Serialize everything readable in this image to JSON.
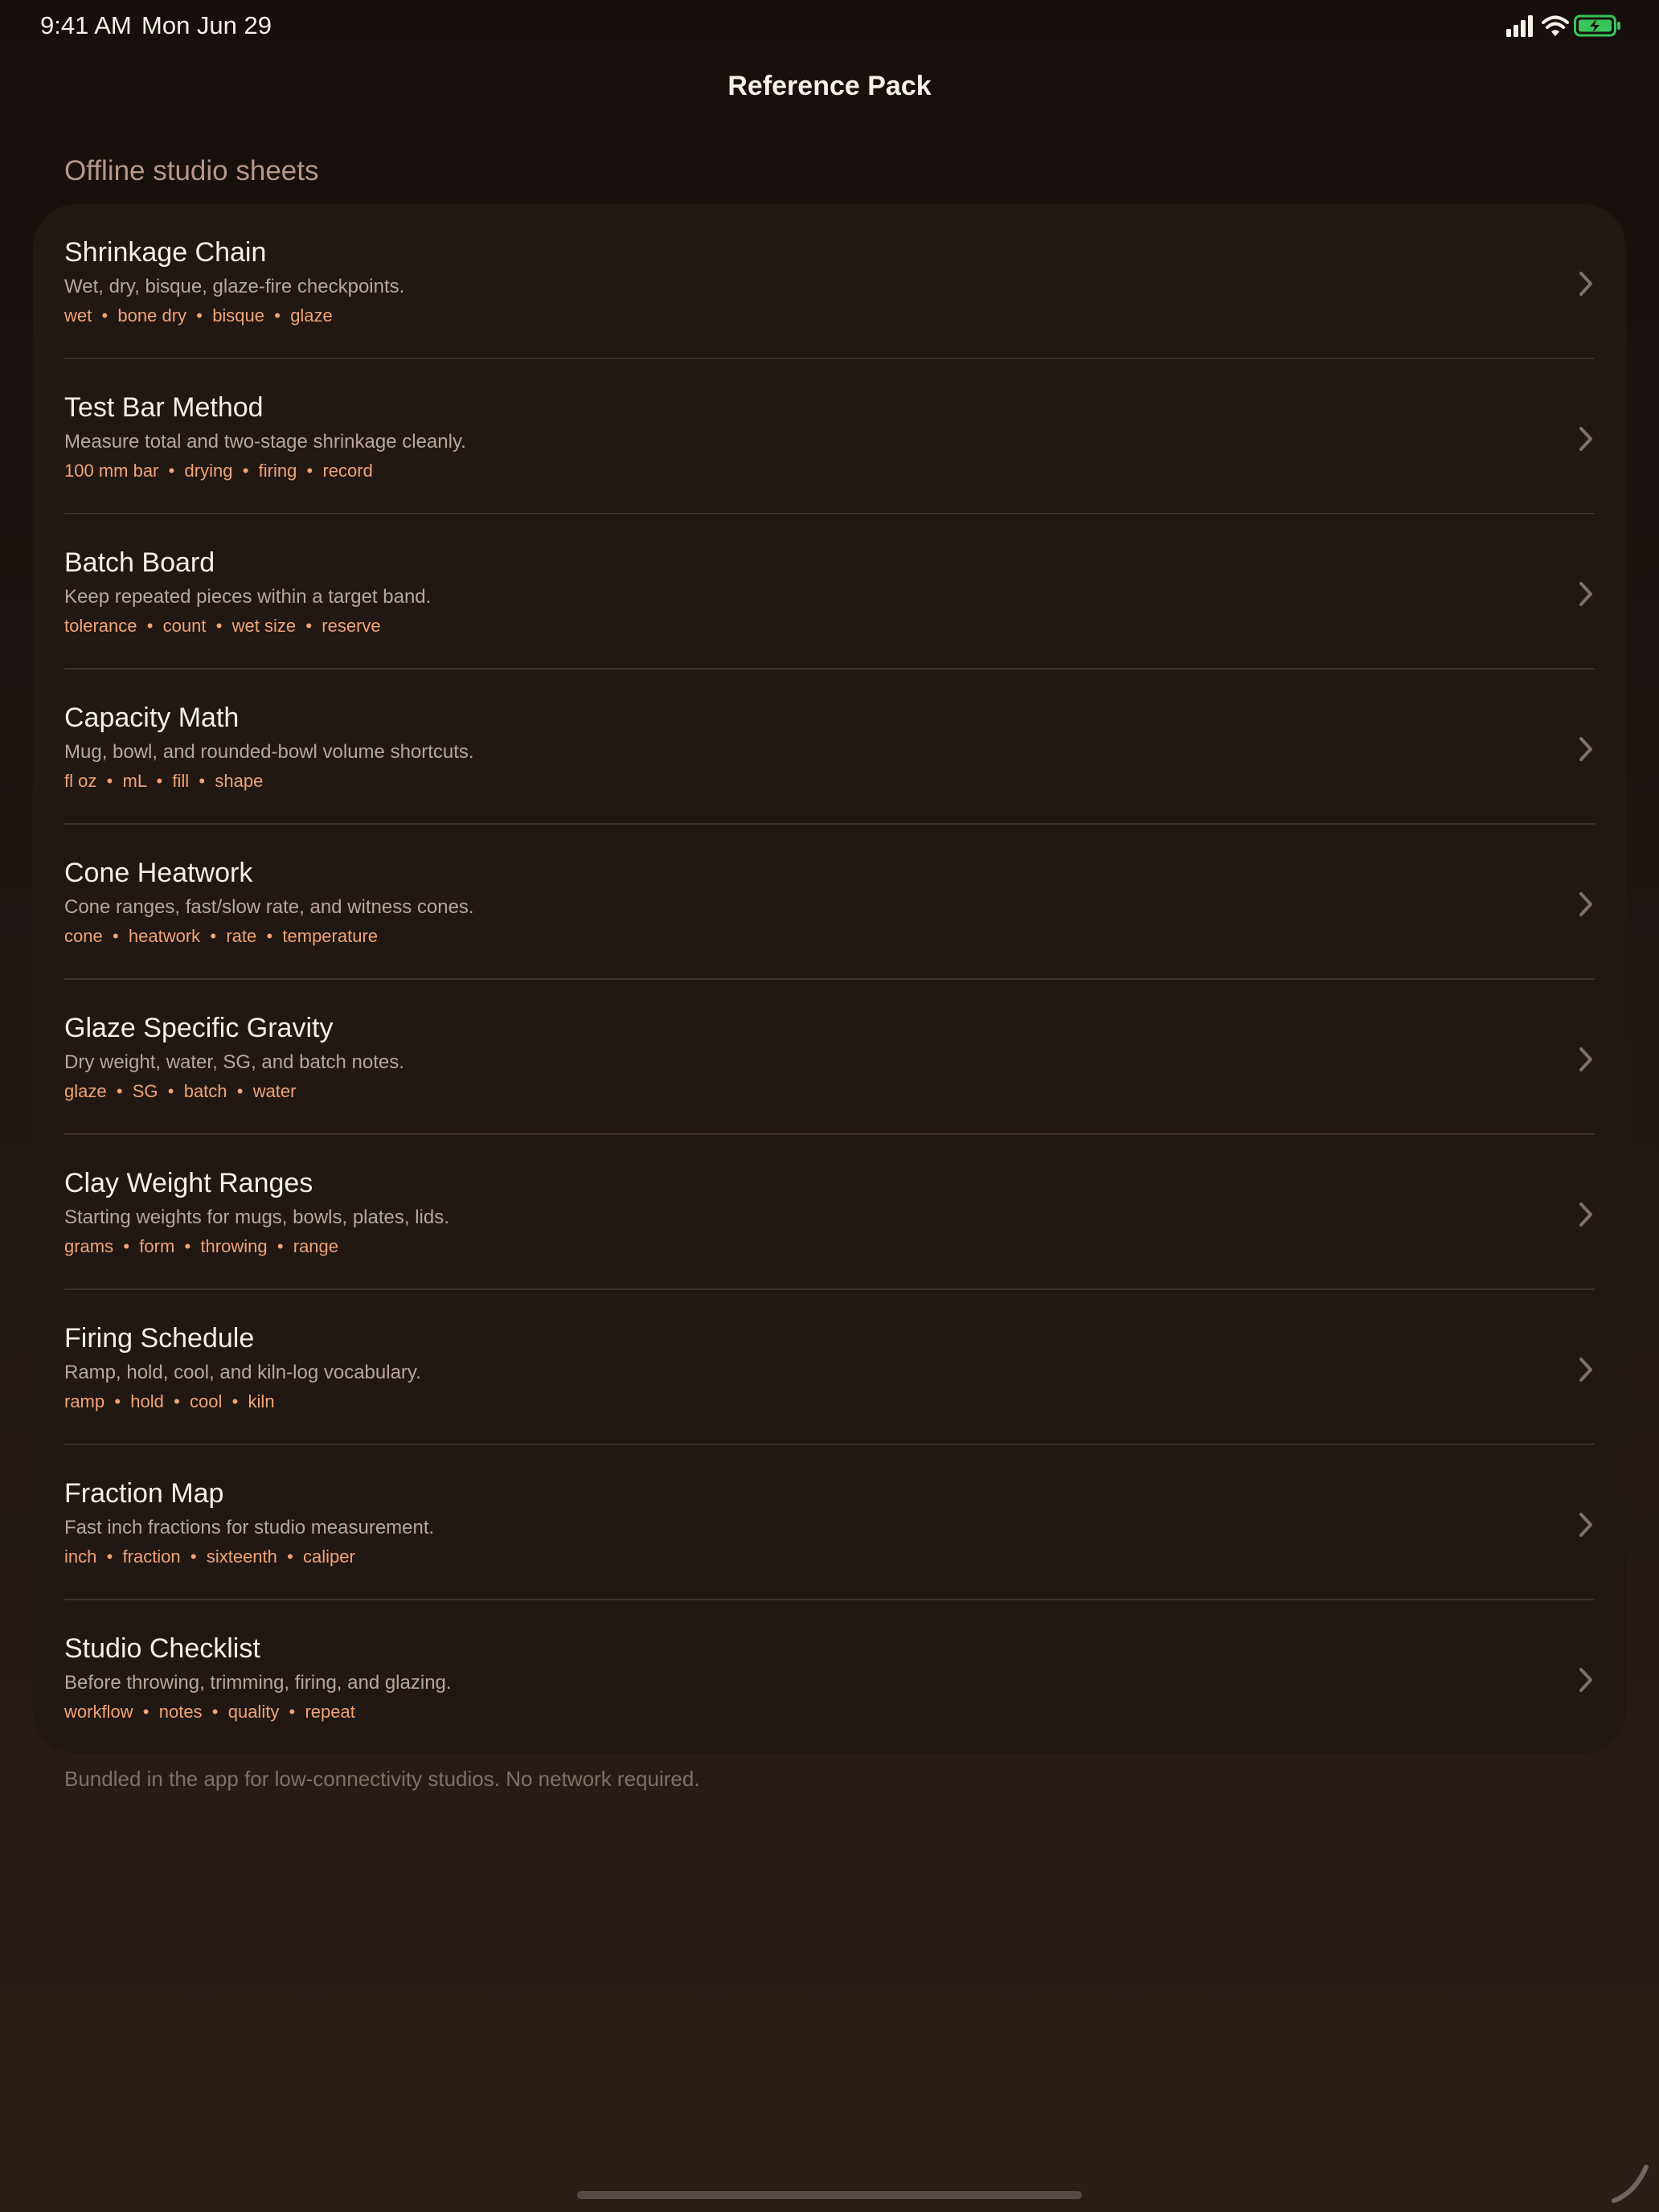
{
  "status_bar": {
    "time": "9:41 AM",
    "date": "Mon Jun 29",
    "icons": [
      "signal-icon",
      "wifi-icon",
      "battery-icon"
    ],
    "battery_color": "#39c45a"
  },
  "nav": {
    "title": "Reference Pack"
  },
  "section": {
    "header": "Offline studio sheets",
    "footer": "Bundled in the app for low-connectivity studios. No network required."
  },
  "colors": {
    "accent": "#f0a476",
    "background": "#1f1612",
    "card": "#211713"
  },
  "items": [
    {
      "title": "Shrinkage Chain",
      "subtitle": "Wet, dry, bisque, glaze-fire checkpoints.",
      "tags": [
        "wet",
        "bone dry",
        "bisque",
        "glaze"
      ]
    },
    {
      "title": "Test Bar Method",
      "subtitle": "Measure total and two-stage shrinkage cleanly.",
      "tags": [
        "100 mm bar",
        "drying",
        "firing",
        "record"
      ]
    },
    {
      "title": "Batch Board",
      "subtitle": "Keep repeated pieces within a target band.",
      "tags": [
        "tolerance",
        "count",
        "wet size",
        "reserve"
      ]
    },
    {
      "title": "Capacity Math",
      "subtitle": "Mug, bowl, and rounded-bowl volume shortcuts.",
      "tags": [
        "fl oz",
        "mL",
        "fill",
        "shape"
      ]
    },
    {
      "title": "Cone Heatwork",
      "subtitle": "Cone ranges, fast/slow rate, and witness cones.",
      "tags": [
        "cone",
        "heatwork",
        "rate",
        "temperature"
      ]
    },
    {
      "title": "Glaze Specific Gravity",
      "subtitle": "Dry weight, water, SG, and batch notes.",
      "tags": [
        "glaze",
        "SG",
        "batch",
        "water"
      ]
    },
    {
      "title": "Clay Weight Ranges",
      "subtitle": "Starting weights for mugs, bowls, plates, lids.",
      "tags": [
        "grams",
        "form",
        "throwing",
        "range"
      ]
    },
    {
      "title": "Firing Schedule",
      "subtitle": "Ramp, hold, cool, and kiln-log vocabulary.",
      "tags": [
        "ramp",
        "hold",
        "cool",
        "kiln"
      ]
    },
    {
      "title": "Fraction Map",
      "subtitle": "Fast inch fractions for studio measurement.",
      "tags": [
        "inch",
        "fraction",
        "sixteenth",
        "caliper"
      ]
    },
    {
      "title": "Studio Checklist",
      "subtitle": "Before throwing, trimming, firing, and glazing.",
      "tags": [
        "workflow",
        "notes",
        "quality",
        "repeat"
      ]
    }
  ]
}
